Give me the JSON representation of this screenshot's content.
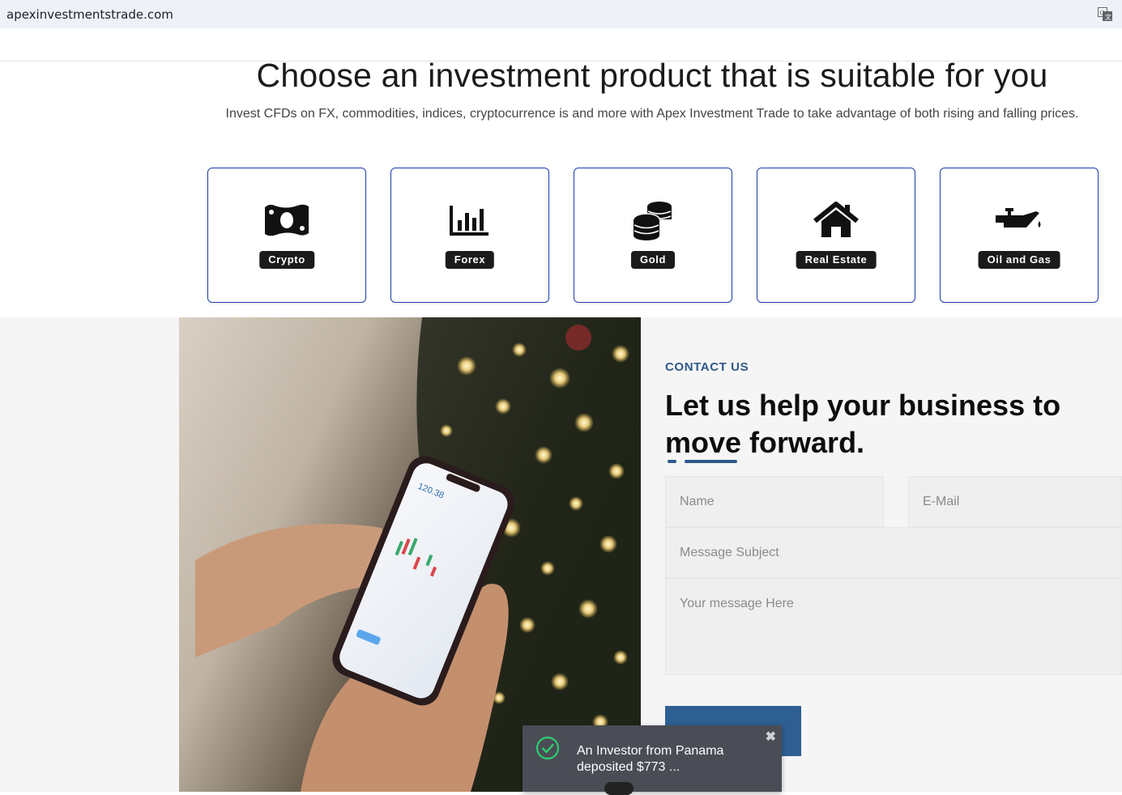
{
  "browser": {
    "url": "apexinvestmentstrade.com",
    "translate_icon": "translate-icon"
  },
  "hero": {
    "title": "Choose an investment product that is suitable for you",
    "subtitle": "Invest CFDs on FX, commodities, indices, cryptocurrence is and more with Apex Investment Trade to take advantage of both rising and falling prices."
  },
  "products": [
    {
      "label": "Crypto",
      "icon": "money-bill-icon"
    },
    {
      "label": "Forex",
      "icon": "bar-chart-icon"
    },
    {
      "label": "Gold",
      "icon": "coins-icon"
    },
    {
      "label": "Real Estate",
      "icon": "house-icon"
    },
    {
      "label": "Oil and Gas",
      "icon": "oil-can-icon"
    }
  ],
  "contact": {
    "kicker": "CONTACT US",
    "heading": "Let us help your business to move forward.",
    "name_placeholder": "Name",
    "email_placeholder": "E-Mail",
    "subject_placeholder": "Message Subject",
    "message_placeholder": "Your message Here",
    "accent_color": "#2e5a8a"
  },
  "notification": {
    "text": "An Investor from Panama deposited $773 ...",
    "close": "✖"
  }
}
